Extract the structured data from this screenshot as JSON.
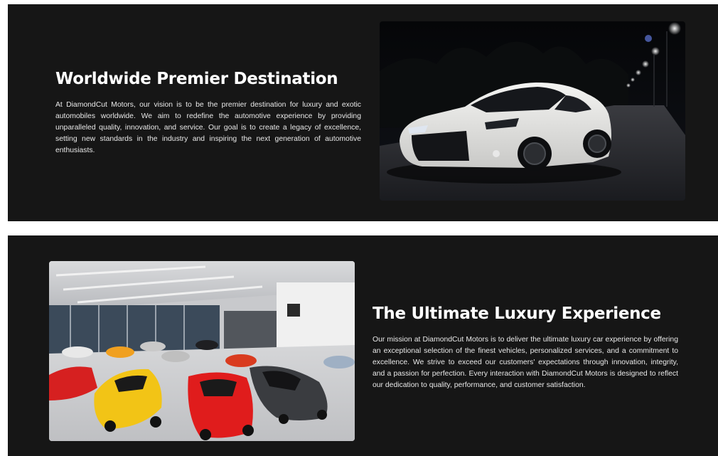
{
  "sections": [
    {
      "title": "Worldwide Premier Destination",
      "body": "At DiamondCut Motors, our vision is to be the premier destination for luxury and exotic automobiles worldwide. We aim to redefine the automotive experience by providing unparalleled quality, innovation, and service. Our goal is to create a legacy of excellence, setting new standards in the industry and inspiring the next generation of automotive enthusiasts.",
      "image": "white-sports-car-night-road-photo"
    },
    {
      "title": "The Ultimate Luxury Experience",
      "body": "Our mission at DiamondCut Motors is to deliver the ultimate luxury car experience by offering an exceptional selection of the finest vehicles, personalized services, and a commitment to excellence. We strive to exceed our customers' expectations through innovation, integrity, and a passion for perfection. Every interaction with DiamondCut Motors is designed to reflect our dedication to quality, performance, and customer satisfaction.",
      "image": "supercar-showroom-photo"
    }
  ],
  "colors": {
    "band_background": "#161616",
    "page_background": "#ffffff",
    "heading": "#ffffff",
    "body": "#e9e9e9"
  }
}
